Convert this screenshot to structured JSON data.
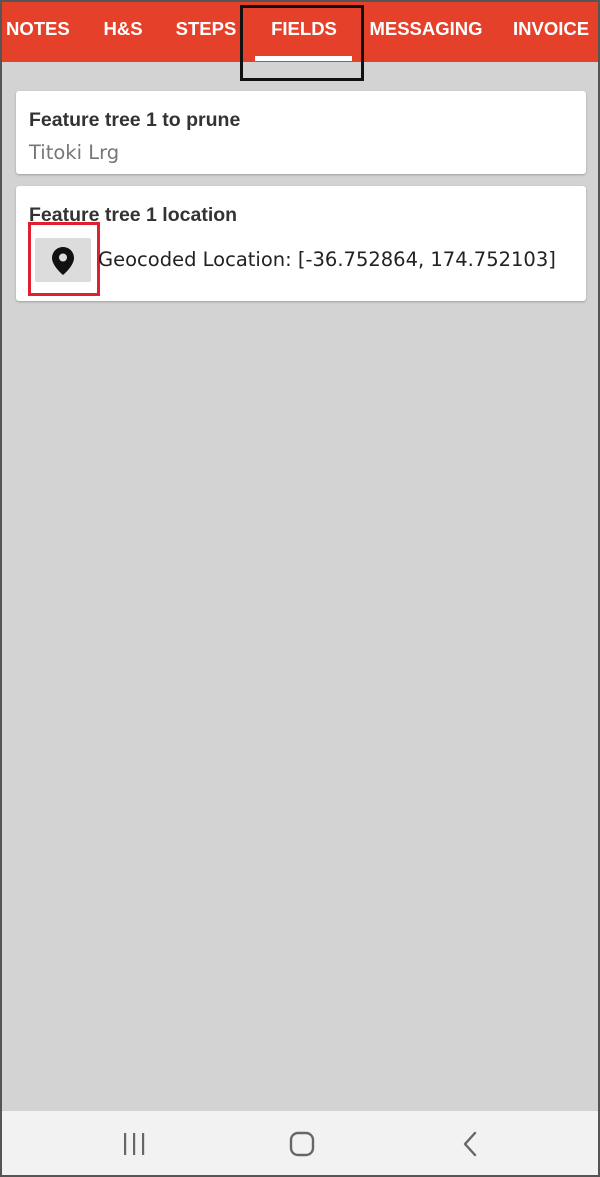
{
  "tabs": {
    "items": [
      {
        "label": "NOTES"
      },
      {
        "label": "H&S"
      },
      {
        "label": "STEPS"
      },
      {
        "label": "FIELDS"
      },
      {
        "label": "MESSAGING"
      },
      {
        "label": "INVOICE"
      }
    ],
    "active": "FIELDS"
  },
  "fields": [
    {
      "title": "Feature tree 1 to prune",
      "value": "Titoki Lrg"
    },
    {
      "title": "Feature tree 1 location",
      "value": "Geocoded Location: [-36.752864, 174.752103]",
      "button_icon": "map-pin-icon"
    }
  ],
  "nav": {
    "recents_icon": "recents-icon",
    "home_icon": "home-icon",
    "back_icon": "back-icon"
  },
  "colors": {
    "tab_bar": "#e5412a",
    "background": "#d3d3d3",
    "card": "#ffffff",
    "highlight_tab": "#111111",
    "highlight_button": "#e02030"
  }
}
